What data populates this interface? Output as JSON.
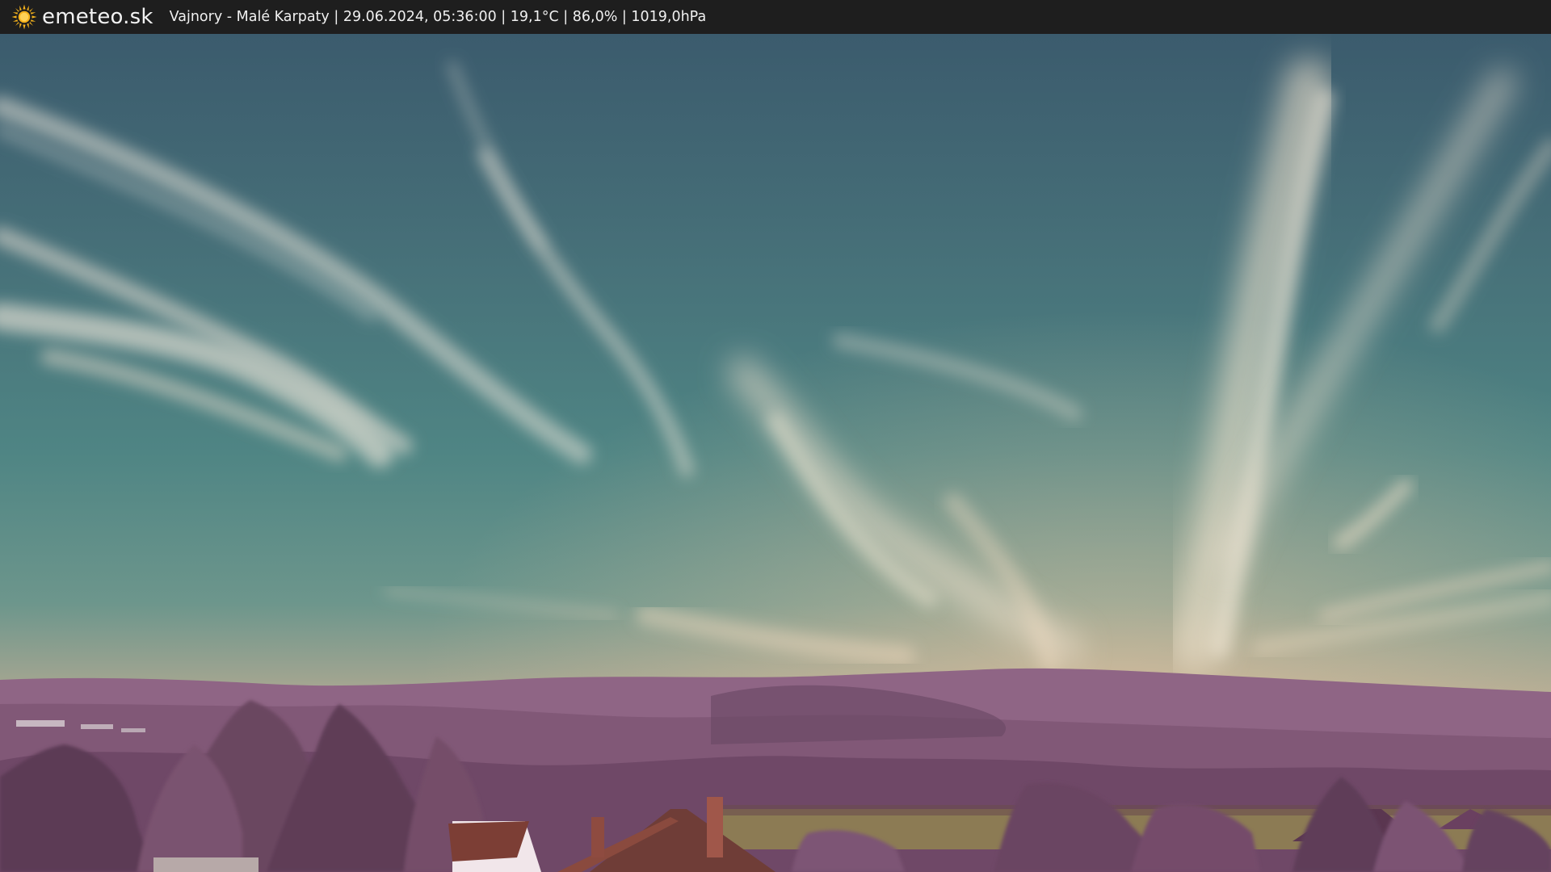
{
  "app": {
    "brand": "emeteo.sk",
    "brand_icon": "sun-icon"
  },
  "caption": {
    "location": "Vajnory - Malé Karpaty",
    "datetime": "29.06.2024, 05:36:00",
    "temperature": "19,1°C",
    "humidity": "86,0%",
    "pressure": "1019,0hPa",
    "separator": " | "
  },
  "colors": {
    "bar_background": "#1e1e1e",
    "bar_text": "#f0f0f0",
    "sun": "#f5b21c",
    "sky_top": "#3d5f6e",
    "sky_mid": "#4f8584",
    "sky_horizon": "#d7b79a",
    "hills": "#8e6584",
    "foliage": "#6b4661",
    "field": "#8a7a52",
    "roof": "#7a3f33"
  }
}
